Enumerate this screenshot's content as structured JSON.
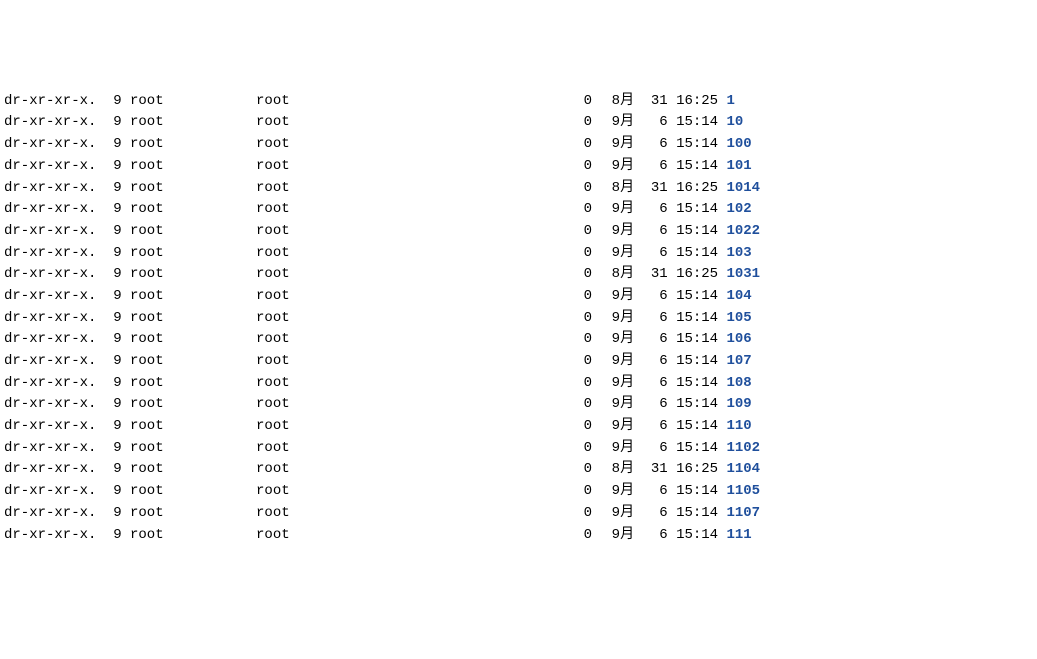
{
  "listing": {
    "entries": [
      {
        "perm": "dr-xr-xr-x.",
        "links": "9",
        "owner": "root",
        "group": "root",
        "size": "0",
        "month": "8月",
        "day": "31",
        "time": "16:25",
        "name": "1"
      },
      {
        "perm": "dr-xr-xr-x.",
        "links": "9",
        "owner": "root",
        "group": "root",
        "size": "0",
        "month": "9月",
        "day": "6",
        "time": "15:14",
        "name": "10"
      },
      {
        "perm": "dr-xr-xr-x.",
        "links": "9",
        "owner": "root",
        "group": "root",
        "size": "0",
        "month": "9月",
        "day": "6",
        "time": "15:14",
        "name": "100"
      },
      {
        "perm": "dr-xr-xr-x.",
        "links": "9",
        "owner": "root",
        "group": "root",
        "size": "0",
        "month": "9月",
        "day": "6",
        "time": "15:14",
        "name": "101"
      },
      {
        "perm": "dr-xr-xr-x.",
        "links": "9",
        "owner": "root",
        "group": "root",
        "size": "0",
        "month": "8月",
        "day": "31",
        "time": "16:25",
        "name": "1014"
      },
      {
        "perm": "dr-xr-xr-x.",
        "links": "9",
        "owner": "root",
        "group": "root",
        "size": "0",
        "month": "9月",
        "day": "6",
        "time": "15:14",
        "name": "102"
      },
      {
        "perm": "dr-xr-xr-x.",
        "links": "9",
        "owner": "root",
        "group": "root",
        "size": "0",
        "month": "9月",
        "day": "6",
        "time": "15:14",
        "name": "1022"
      },
      {
        "perm": "dr-xr-xr-x.",
        "links": "9",
        "owner": "root",
        "group": "root",
        "size": "0",
        "month": "9月",
        "day": "6",
        "time": "15:14",
        "name": "103"
      },
      {
        "perm": "dr-xr-xr-x.",
        "links": "9",
        "owner": "root",
        "group": "root",
        "size": "0",
        "month": "8月",
        "day": "31",
        "time": "16:25",
        "name": "1031"
      },
      {
        "perm": "dr-xr-xr-x.",
        "links": "9",
        "owner": "root",
        "group": "root",
        "size": "0",
        "month": "9月",
        "day": "6",
        "time": "15:14",
        "name": "104"
      },
      {
        "perm": "dr-xr-xr-x.",
        "links": "9",
        "owner": "root",
        "group": "root",
        "size": "0",
        "month": "9月",
        "day": "6",
        "time": "15:14",
        "name": "105"
      },
      {
        "perm": "dr-xr-xr-x.",
        "links": "9",
        "owner": "root",
        "group": "root",
        "size": "0",
        "month": "9月",
        "day": "6",
        "time": "15:14",
        "name": "106"
      },
      {
        "perm": "dr-xr-xr-x.",
        "links": "9",
        "owner": "root",
        "group": "root",
        "size": "0",
        "month": "9月",
        "day": "6",
        "time": "15:14",
        "name": "107"
      },
      {
        "perm": "dr-xr-xr-x.",
        "links": "9",
        "owner": "root",
        "group": "root",
        "size": "0",
        "month": "9月",
        "day": "6",
        "time": "15:14",
        "name": "108"
      },
      {
        "perm": "dr-xr-xr-x.",
        "links": "9",
        "owner": "root",
        "group": "root",
        "size": "0",
        "month": "9月",
        "day": "6",
        "time": "15:14",
        "name": "109"
      },
      {
        "perm": "dr-xr-xr-x.",
        "links": "9",
        "owner": "root",
        "group": "root",
        "size": "0",
        "month": "9月",
        "day": "6",
        "time": "15:14",
        "name": "110"
      },
      {
        "perm": "dr-xr-xr-x.",
        "links": "9",
        "owner": "root",
        "group": "root",
        "size": "0",
        "month": "9月",
        "day": "6",
        "time": "15:14",
        "name": "1102"
      },
      {
        "perm": "dr-xr-xr-x.",
        "links": "9",
        "owner": "root",
        "group": "root",
        "size": "0",
        "month": "8月",
        "day": "31",
        "time": "16:25",
        "name": "1104"
      },
      {
        "perm": "dr-xr-xr-x.",
        "links": "9",
        "owner": "root",
        "group": "root",
        "size": "0",
        "month": "9月",
        "day": "6",
        "time": "15:14",
        "name": "1105"
      },
      {
        "perm": "dr-xr-xr-x.",
        "links": "9",
        "owner": "root",
        "group": "root",
        "size": "0",
        "month": "9月",
        "day": "6",
        "time": "15:14",
        "name": "1107"
      },
      {
        "perm": "dr-xr-xr-x.",
        "links": "9",
        "owner": "root",
        "group": "root",
        "size": "0",
        "month": "9月",
        "day": "6",
        "time": "15:14",
        "name": "111"
      }
    ]
  },
  "colors": {
    "dir_name": "#1f4f9c"
  }
}
